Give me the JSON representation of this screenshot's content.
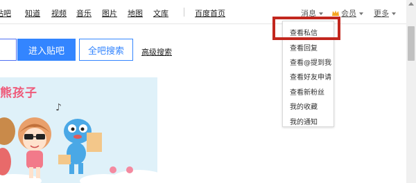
{
  "nav": {
    "links": [
      "贴吧",
      "知道",
      "视频",
      "音乐",
      "图片",
      "地图",
      "文库"
    ],
    "home": "百度首页",
    "messages": "消息",
    "vip": "会员",
    "more": "更多"
  },
  "search": {
    "enter_button": "进入贴吧",
    "all_search_button": "全吧搜索",
    "advanced": "高级搜索"
  },
  "banner": {
    "title": "熊孩子"
  },
  "dropdown": {
    "items": [
      "查看私信",
      "查看回复",
      "查看@提到我",
      "查看好友申请",
      "查看新粉丝",
      "我的收藏",
      "我的通知"
    ]
  },
  "colors": {
    "primary": "#3385ff",
    "highlight": "#c2271e",
    "vip": "#f5a623"
  }
}
